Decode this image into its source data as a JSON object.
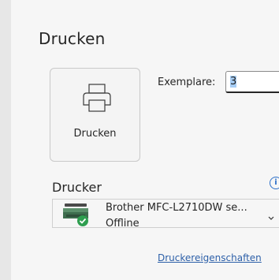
{
  "page": {
    "title": "Drucken"
  },
  "print_button": {
    "label": "Drucken",
    "icon": "printer-icon"
  },
  "copies": {
    "label": "Exemplare:",
    "value": "3"
  },
  "printer_section": {
    "title": "Drucker",
    "info_icon": "info-icon",
    "info_glyph": "i",
    "selected_printer": {
      "name": "Brother MFC-L2710DW se...",
      "status": "Offline",
      "status_icon": "check-badge"
    },
    "properties_link": "Druckereigenschaften"
  },
  "colors": {
    "status_green": "#2e9e4f",
    "link_blue": "#2c5fa8",
    "selection_blue": "#a6cdf5"
  }
}
